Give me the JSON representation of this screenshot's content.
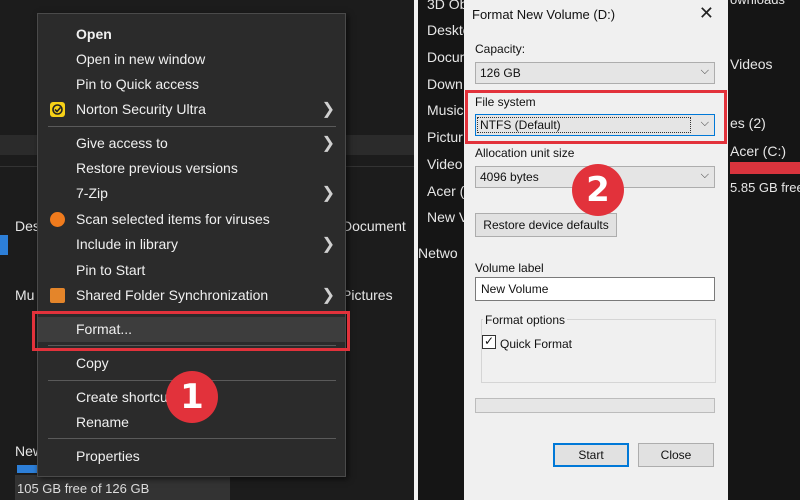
{
  "explorer_left": {
    "bg_labels": [
      "Des",
      "Mu",
      "New",
      "Document",
      "Pictures"
    ],
    "status_text": "105 GB free of 126 GB"
  },
  "context_menu": {
    "items": [
      {
        "label": "Open",
        "bold": true
      },
      {
        "label": "Open in new window"
      },
      {
        "label": "Pin to Quick access"
      },
      {
        "label": "Norton Security Ultra",
        "icon": "norton-icon",
        "submenu": true
      },
      {
        "label": "Give access to",
        "submenu": true
      },
      {
        "label": "Restore previous versions"
      },
      {
        "label": "7-Zip",
        "submenu": true
      },
      {
        "label": "Scan selected items for viruses",
        "icon": "avast-icon"
      },
      {
        "label": "Include in library",
        "submenu": true
      },
      {
        "label": "Pin to Start"
      },
      {
        "label": "Shared Folder Synchronization",
        "icon": "sync-icon",
        "submenu": true
      },
      {
        "label": "Format..."
      },
      {
        "label": "Copy"
      },
      {
        "label": "Create shortcut"
      },
      {
        "label": "Rename"
      },
      {
        "label": "Properties"
      }
    ],
    "arrow_glyph": "❯",
    "step_badge": "1"
  },
  "explorer_right": {
    "nav_items": [
      "3D Ob",
      "Deskto",
      "Docum",
      "Down",
      "Music",
      "Pictur",
      "Video",
      "Acer (",
      "New V",
      "Netwo"
    ],
    "right_labels": [
      "Videos",
      "es (2)",
      "Acer (C:)",
      "5.85 GB free o",
      "ownloads"
    ]
  },
  "format_dialog": {
    "title": "Format New Volume (D:)",
    "close_glyph": "✕",
    "capacity_label": "Capacity:",
    "capacity_value": "126 GB",
    "file_system_label": "File system",
    "file_system_value": "NTFS (Default)",
    "allocation_label": "Allocation unit size",
    "allocation_value": "4096 bytes",
    "restore_button": "Restore device defaults",
    "volume_label_label": "Volume label",
    "volume_label_value": "New Volume",
    "format_options_label": "Format options",
    "quick_format_label": "Quick Format",
    "quick_format_checked": true,
    "start_button": "Start",
    "close_button": "Close",
    "step_badge": "2"
  },
  "colors": {
    "highlight": "#e2323b",
    "menu_bg": "#2b2b2b"
  }
}
